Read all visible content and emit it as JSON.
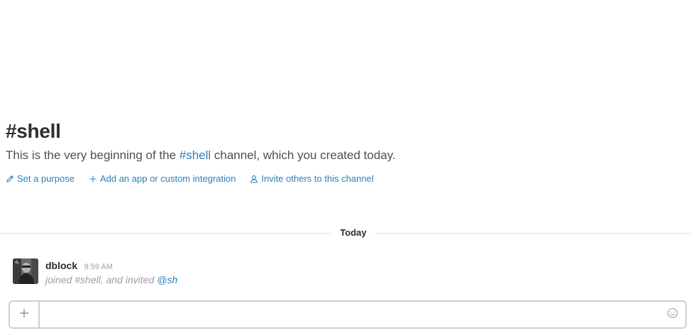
{
  "channel": {
    "title": "#shell",
    "description_prefix": "This is the very beginning of the ",
    "description_link": "#shell",
    "description_suffix": " channel, which you created today."
  },
  "actions": [
    {
      "label": "Set a purpose",
      "icon": "pencil-icon"
    },
    {
      "label": "Add an app or custom integration",
      "icon": "plus-icon"
    },
    {
      "label": "Invite others to this channel",
      "icon": "person-icon"
    }
  ],
  "divider": {
    "label": "Today"
  },
  "messages": [
    {
      "author": "dblock",
      "time": "9:59 AM",
      "body_prefix": "joined #shell, and invited ",
      "mention": "@sh",
      "avatar_icon": "user-avatar"
    }
  ],
  "composer": {
    "value": "",
    "placeholder": "",
    "attach_icon": "plus-icon",
    "emoji_icon": "smiley-icon"
  },
  "colors": {
    "link": "#2a80b9",
    "text": "#2c2d30",
    "muted": "#9e9ea6",
    "border": "#cfcfd1"
  }
}
